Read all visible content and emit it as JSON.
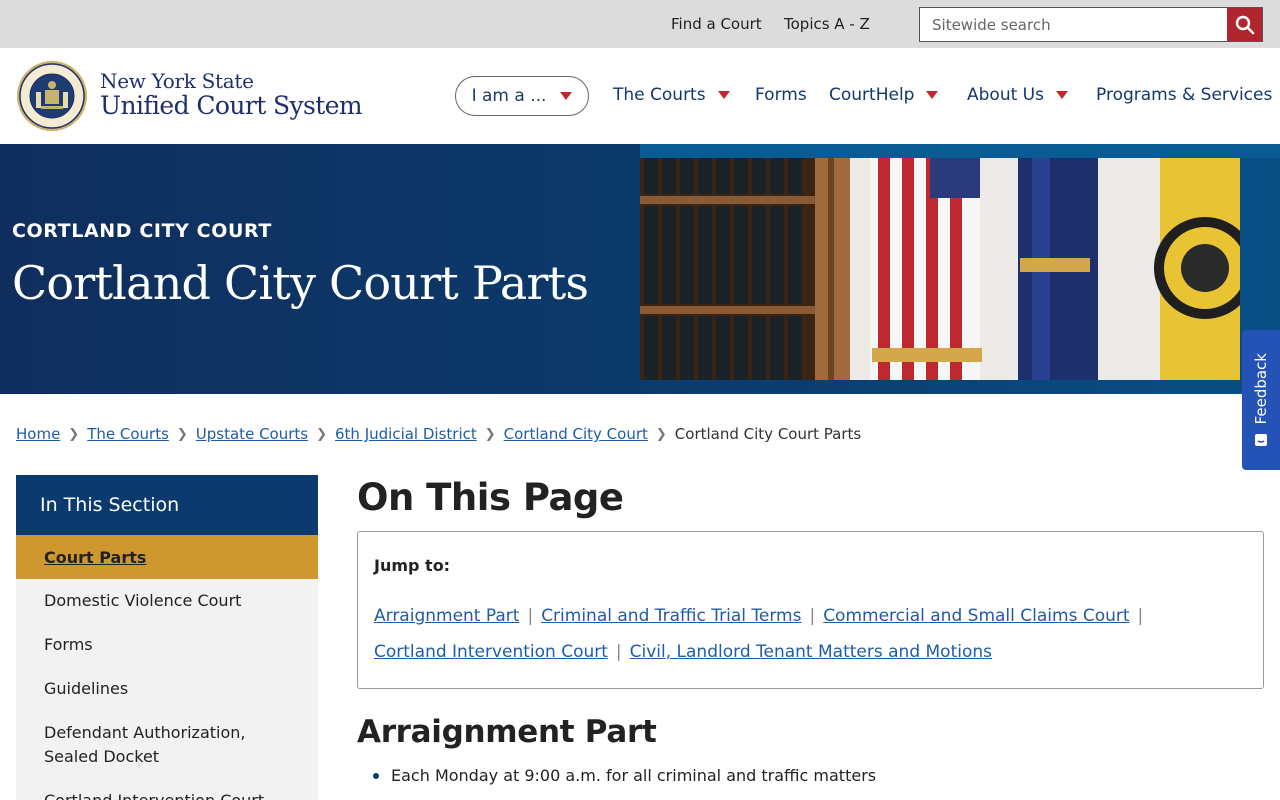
{
  "utility": {
    "links": [
      "Find a Court",
      "Topics A - Z"
    ],
    "search_placeholder": "Sitewide search"
  },
  "logo": {
    "line1": "New York State",
    "line2": "Unified Court System"
  },
  "nav": {
    "iam_label": "I am a ...",
    "items": [
      {
        "label": "The Courts"
      },
      {
        "label": "Forms"
      },
      {
        "label": "CourtHelp"
      },
      {
        "label": "About Us"
      },
      {
        "label": "Programs & Services"
      }
    ]
  },
  "hero": {
    "kicker": "CORTLAND CITY COURT",
    "title": "Cortland City Court Parts"
  },
  "feedback": {
    "label": "Feedback"
  },
  "breadcrumb": {
    "links": [
      "Home",
      "The Courts",
      "Upstate Courts",
      "6th Judicial District",
      "Cortland City Court"
    ],
    "current": "Cortland City Court Parts"
  },
  "sidebar": {
    "heading": "In This Section",
    "active": "Court Parts",
    "items": [
      "Domestic Violence Court",
      "Forms",
      "Guidelines",
      "Defendant Authorization, Sealed Docket",
      "Cortland Intervention Court"
    ]
  },
  "main": {
    "title": "On This Page",
    "jump_label": "Jump to:",
    "jump_links": [
      "Arraignment Part",
      "Criminal and Traffic Trial Terms",
      "Commercial and Small Claims Court",
      "Cortland Intervention Court",
      "Civil, Landlord Tenant Matters and Motions"
    ],
    "section_title": "Arraignment Part",
    "bullets": [
      "Each Monday at 9:00 a.m. for all criminal and traffic matters"
    ]
  },
  "colors": {
    "navy": "#0a3a6e",
    "accent_red": "#b0262f",
    "gold": "#cf982f",
    "link_blue": "#1f5ca8"
  }
}
